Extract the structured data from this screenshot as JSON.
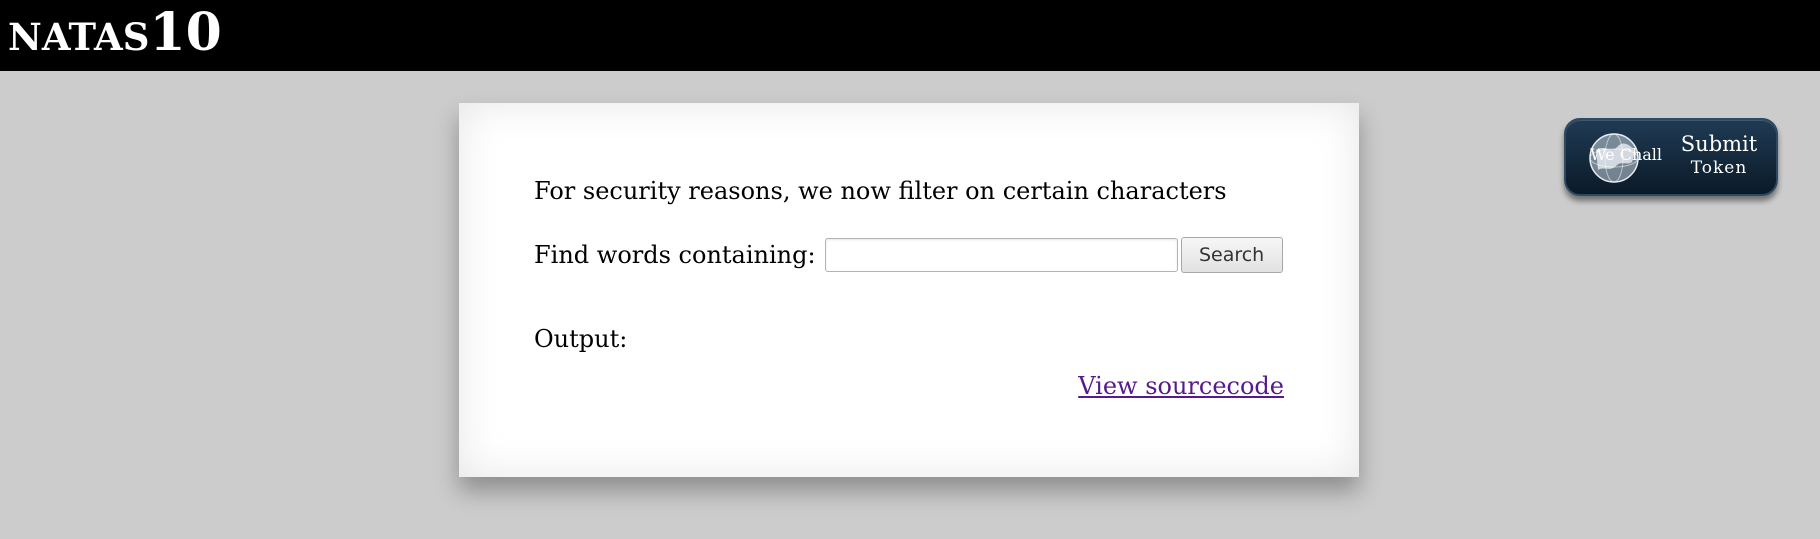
{
  "header": {
    "logo_name": "NATAS",
    "logo_number": "10"
  },
  "main": {
    "intro": "For security reasons, we now filter on certain characters",
    "find_label": "Find words containing:",
    "search_value": "",
    "search_button": "Search",
    "output_label": "Output:",
    "source_link": "View sourcecode"
  },
  "wechall": {
    "brand": "We Chall",
    "line1": "Submit",
    "line2": "Token",
    "icon": "globe-icon"
  },
  "colors": {
    "background": "#cccccc",
    "header": "#000000",
    "link": "#551a8b",
    "badge": "#102638"
  }
}
